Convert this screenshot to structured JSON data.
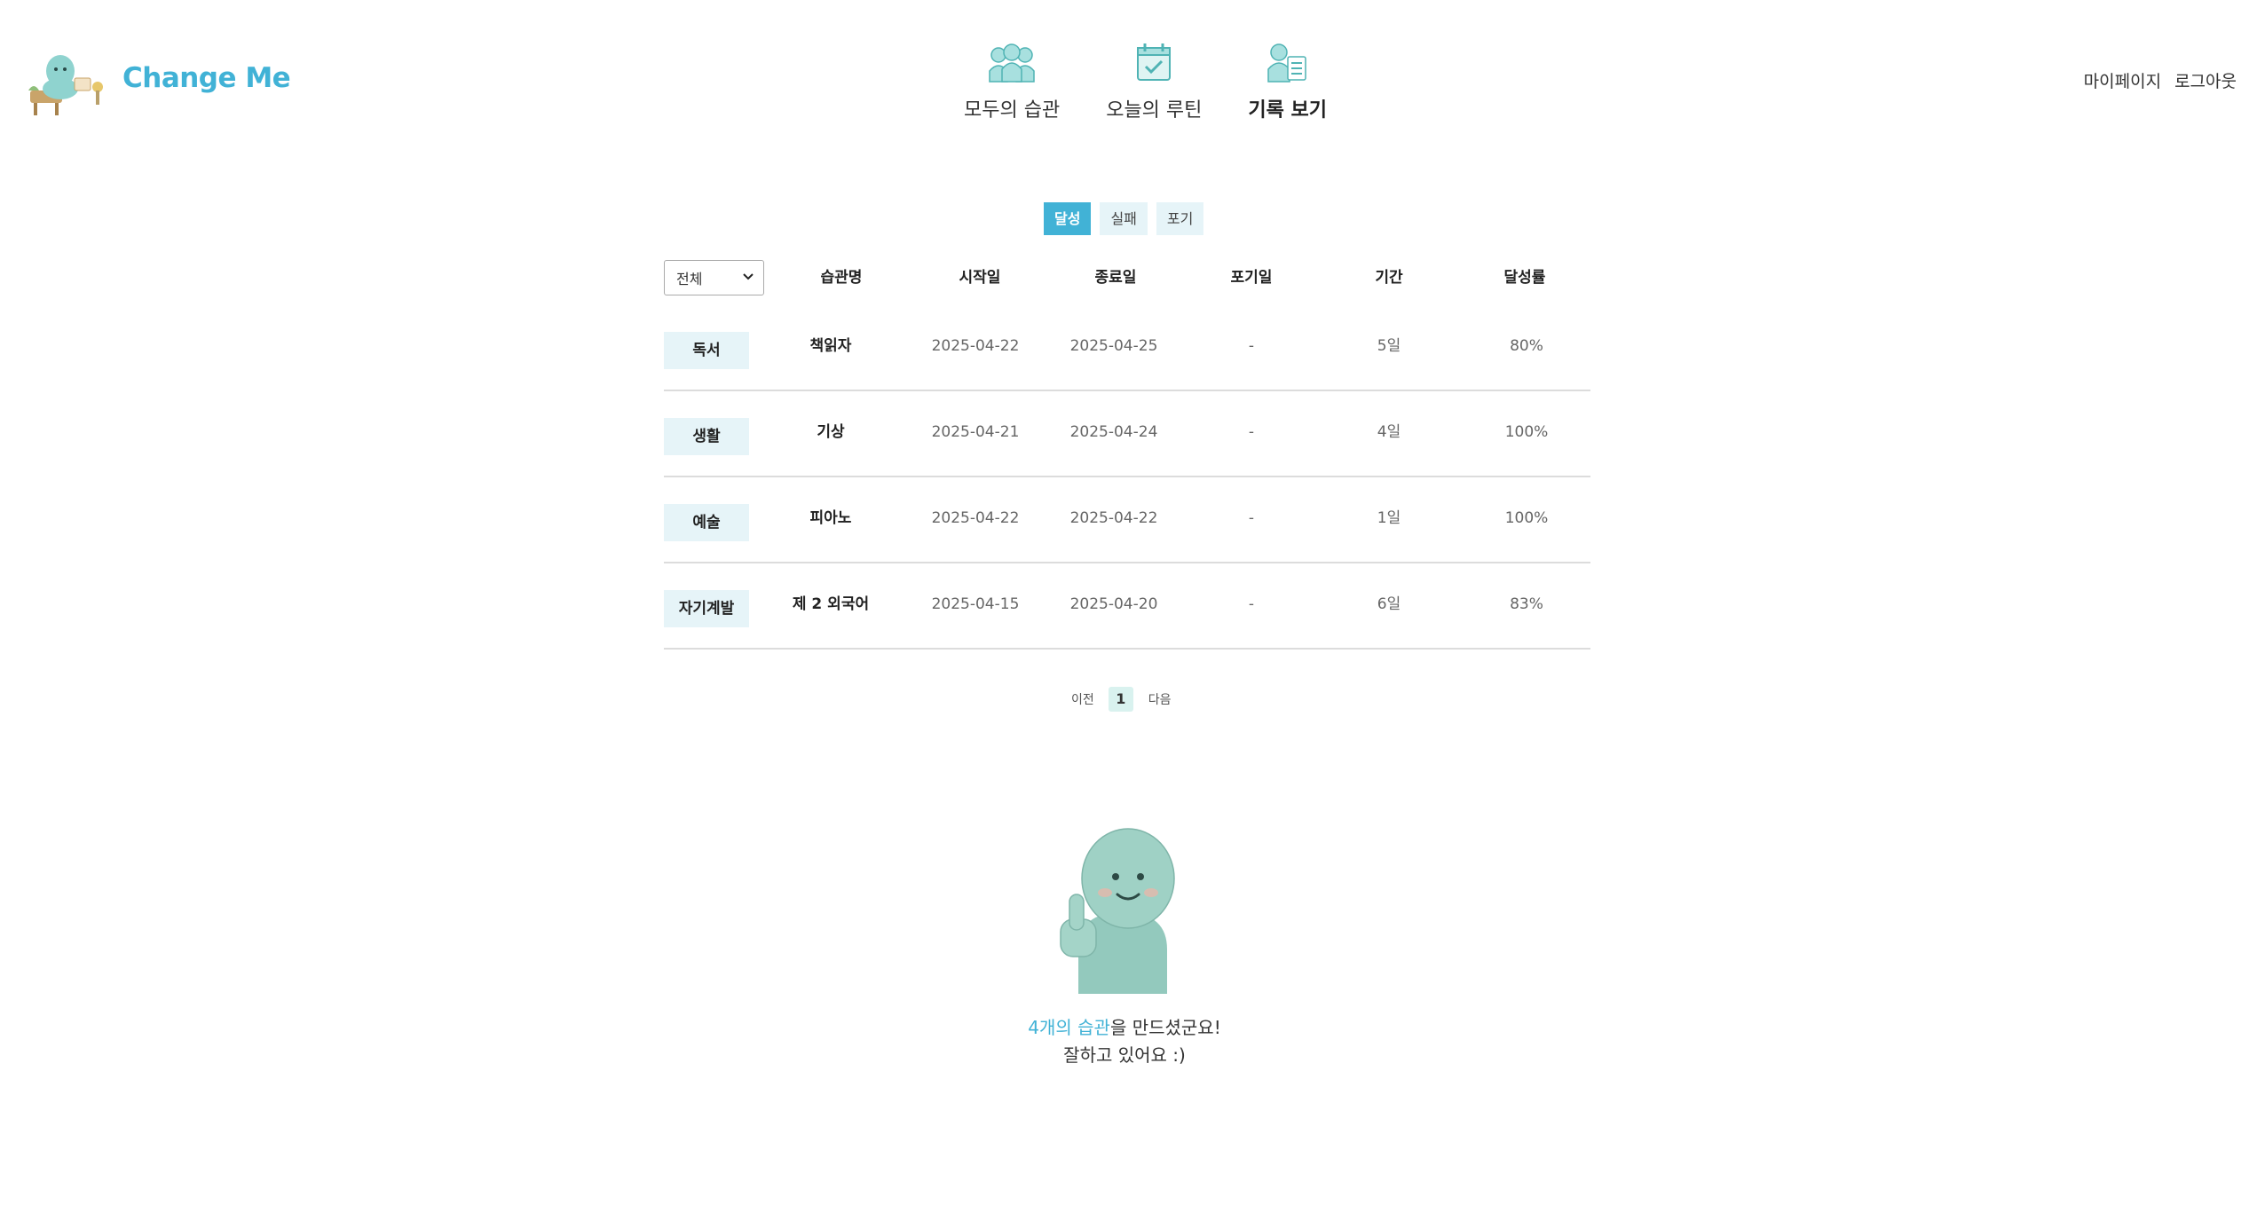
{
  "brand": {
    "name": "Change Me",
    "accent_color": "#41b2d6"
  },
  "nav": [
    {
      "label": "모두의 습관",
      "icon": "group-icon",
      "active": false
    },
    {
      "label": "오늘의 루틴",
      "icon": "calendar-check-icon",
      "active": false
    },
    {
      "label": "기록 보기",
      "icon": "record-list-icon",
      "active": true
    }
  ],
  "user_menu": {
    "mypage": "마이페이지",
    "logout": "로그아웃"
  },
  "status_tabs": [
    {
      "label": "달성",
      "active": true
    },
    {
      "label": "실패",
      "active": false
    },
    {
      "label": "포기",
      "active": false
    }
  ],
  "filter": {
    "selected": "전체"
  },
  "table": {
    "headers": {
      "name": "습관명",
      "start": "시작일",
      "end": "종료일",
      "giveup": "포기일",
      "period": "기간",
      "rate": "달성률"
    },
    "rows": [
      {
        "category": "독서",
        "name": "책읽자",
        "start": "2025-04-22",
        "end": "2025-04-25",
        "giveup": "-",
        "period": "5일",
        "rate": "80%"
      },
      {
        "category": "생활",
        "name": "기상",
        "start": "2025-04-21",
        "end": "2025-04-24",
        "giveup": "-",
        "period": "4일",
        "rate": "100%"
      },
      {
        "category": "예술",
        "name": "피아노",
        "start": "2025-04-22",
        "end": "2025-04-22",
        "giveup": "-",
        "period": "1일",
        "rate": "100%"
      },
      {
        "category": "자기계발",
        "name": "제 2 외국어",
        "start": "2025-04-15",
        "end": "2025-04-20",
        "giveup": "-",
        "period": "6일",
        "rate": "83%"
      }
    ]
  },
  "pagination": {
    "prev": "이전",
    "current": "1",
    "next": "다음"
  },
  "message": {
    "highlight": "4개의 습관",
    "rest": "을 만드셨군요!",
    "line2": "잘하고 있어요 :)"
  }
}
